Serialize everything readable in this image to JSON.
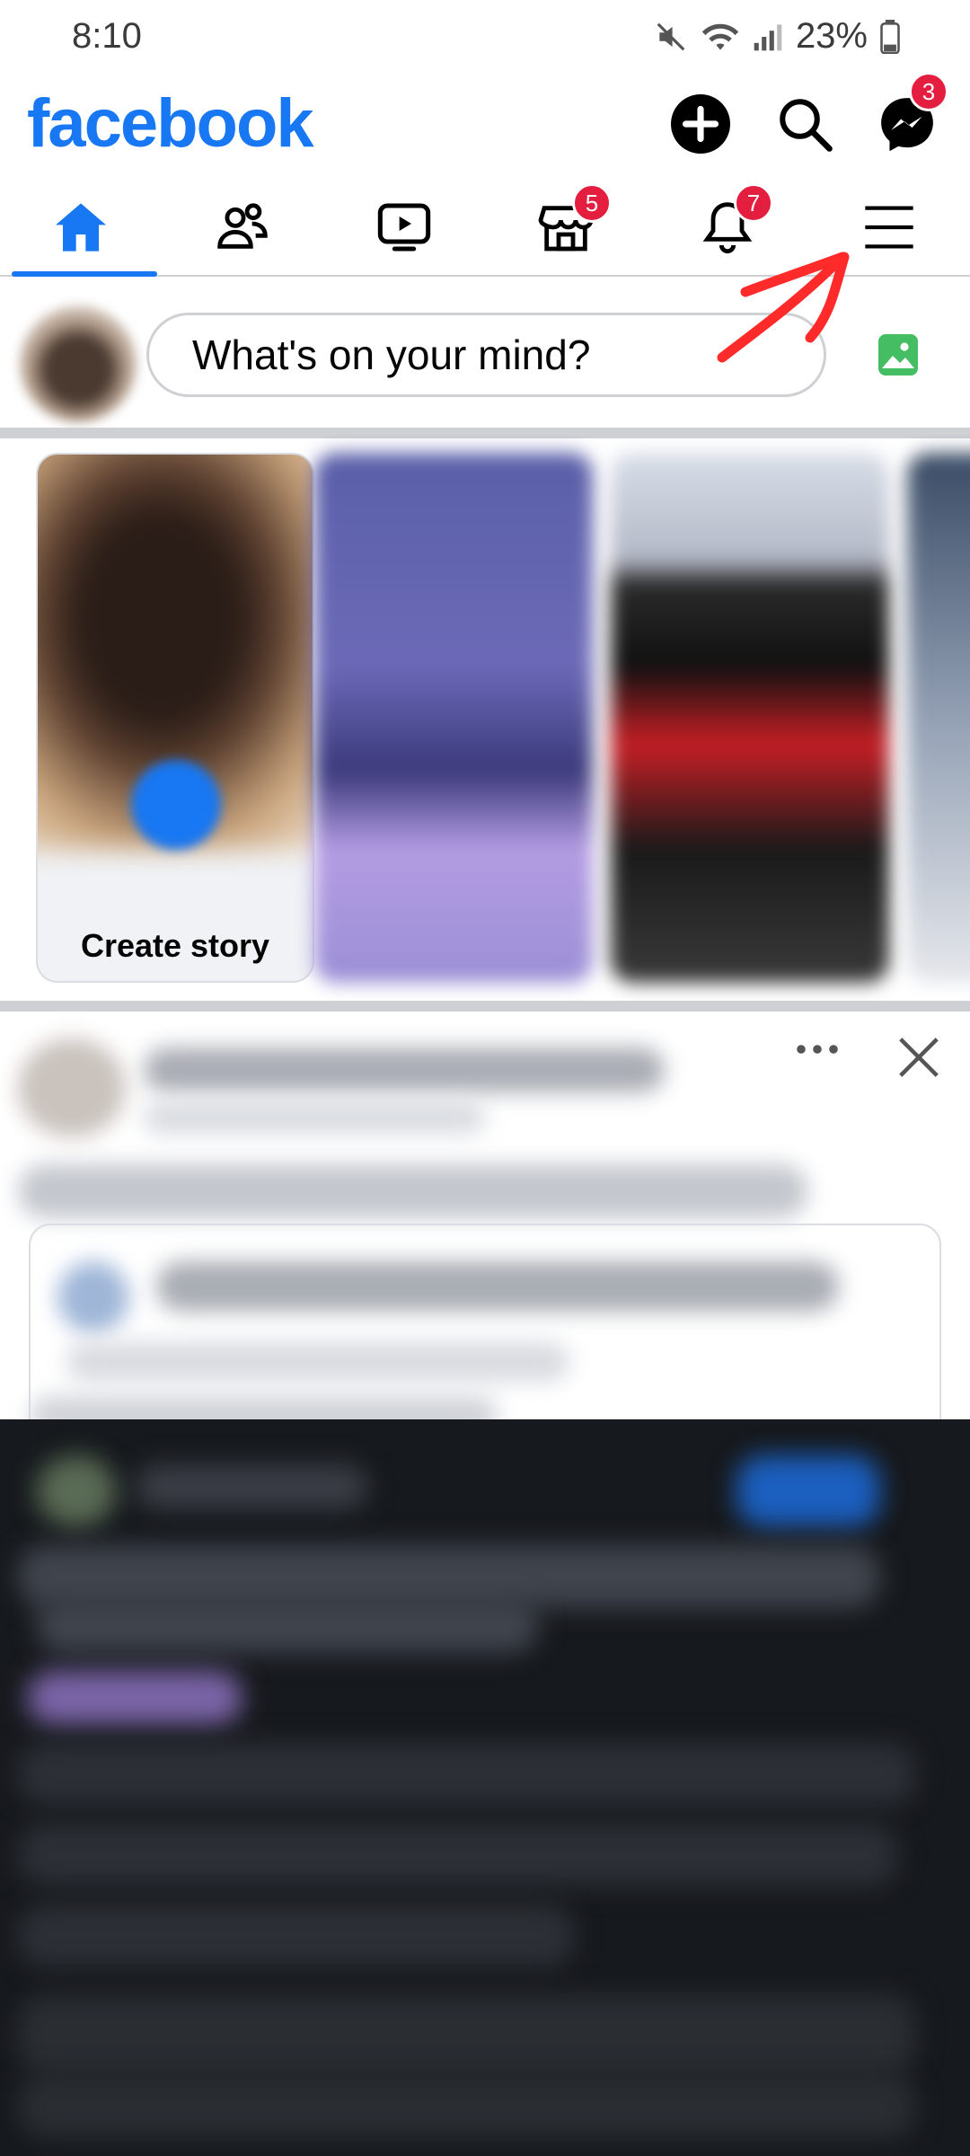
{
  "status_bar": {
    "time": "8:10",
    "battery": "23%",
    "icons": [
      "mute-icon",
      "wifi-icon",
      "signal-icon",
      "battery-icon"
    ]
  },
  "header": {
    "logo": "facebook",
    "brand_color": "#1877f2",
    "actions": [
      {
        "name": "create-icon"
      },
      {
        "name": "search-icon"
      },
      {
        "name": "messenger-icon",
        "badge": "3"
      }
    ]
  },
  "tabs": [
    {
      "name": "home-icon",
      "active": true
    },
    {
      "name": "friends-icon"
    },
    {
      "name": "video-icon"
    },
    {
      "name": "marketplace-icon",
      "badge": "5"
    },
    {
      "name": "notifications-icon",
      "badge": "7"
    },
    {
      "name": "menu-icon"
    }
  ],
  "composer": {
    "placeholder": "What's on your mind?",
    "photo_icon": "photo-icon"
  },
  "stories": {
    "create_label": "Create story"
  },
  "post": {
    "more_icon": "more-icon",
    "close_icon": "close-icon"
  },
  "annotation": {
    "arrow_color": "#ff2a2a"
  }
}
